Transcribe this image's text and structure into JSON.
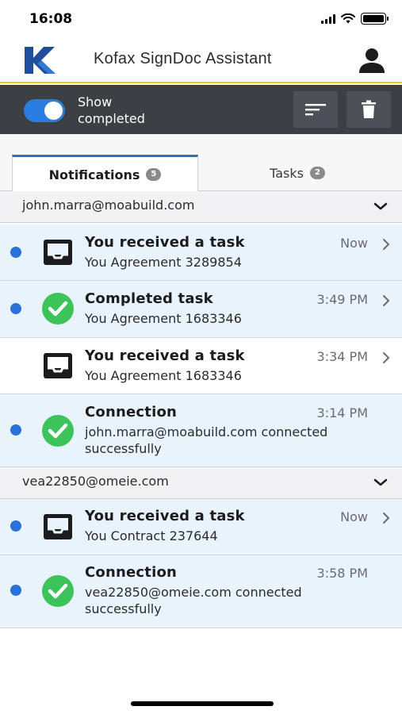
{
  "status_bar": {
    "time": "16:08"
  },
  "header": {
    "title": "Kofax SignDoc Assistant"
  },
  "toolbar": {
    "toggle_label": "Show completed",
    "toggle_on": true
  },
  "tabs": [
    {
      "label": "Notifications",
      "badge": "5",
      "active": true
    },
    {
      "label": "Tasks",
      "badge": "2",
      "active": false
    }
  ],
  "groups": [
    {
      "email": "john.marra@moabuild.com",
      "items": [
        {
          "title": "You received a task",
          "subtitle": "You Agreement 3289854",
          "time": "Now",
          "icon": "inbox-tray-icon",
          "unread": true,
          "arrow": true
        },
        {
          "title": "Completed task",
          "subtitle": "You Agreement 1683346",
          "time": "3:49 PM",
          "icon": "green-check-icon",
          "unread": true,
          "arrow": true
        },
        {
          "title": "You received a task",
          "subtitle": "You Agreement 1683346",
          "time": "3:34 PM",
          "icon": "inbox-tray-icon",
          "unread": false,
          "arrow": true
        },
        {
          "title": "Connection",
          "subtitle": "john.marra@moabuild.com connected successfully",
          "time": "3:14 PM",
          "icon": "green-check-icon",
          "unread": true,
          "arrow": false
        }
      ]
    },
    {
      "email": "vea22850@omeie.com",
      "items": [
        {
          "title": "You received a task",
          "subtitle": "You Contract 237644",
          "time": "Now",
          "icon": "inbox-tray-icon",
          "unread": true,
          "arrow": true
        },
        {
          "title": "Connection",
          "subtitle": "vea22850@omeie.com connected successfully",
          "time": "3:58 PM",
          "icon": "green-check-icon",
          "unread": true,
          "arrow": false
        }
      ]
    }
  ],
  "colors": {
    "accent": "#2a7de1",
    "unread_bg": "#e8f3fc",
    "toolbar_bg": "#3c3f44",
    "check_green": "#3cc35a",
    "brand_blue": "#1f4e9c"
  }
}
